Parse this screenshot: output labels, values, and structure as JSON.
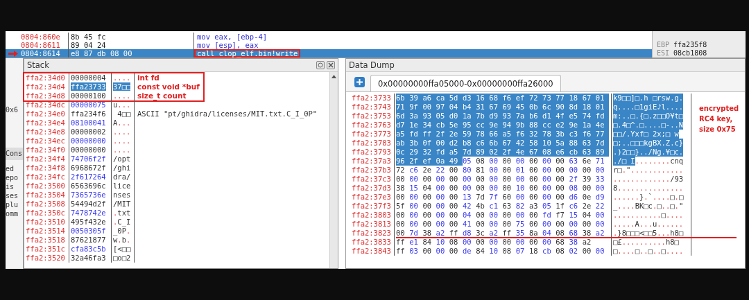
{
  "disassembly": {
    "rows": [
      {
        "address": "0804:860e",
        "bytes": "8b 45 fc",
        "instruction": "mov eax, [ebp-4]",
        "current": false,
        "annotated": false
      },
      {
        "address": "0804:8611",
        "bytes": "89 04 24",
        "instruction": "mov [esp], eax",
        "current": false,
        "annotated": false
      },
      {
        "address": "0804:8614",
        "bytes": "e8 87 db 08 00",
        "instruction": "call clop_elf.bin!write",
        "current": true,
        "annotated": true
      }
    ]
  },
  "registers": [
    {
      "name": "EBP",
      "value": "ffa235f8"
    },
    {
      "name": "ESI",
      "value": "08cb1808"
    }
  ],
  "side_panel": {
    "address": "0x6",
    "tab": "Cons",
    "lines": [
      "ed",
      "epo",
      "is",
      "ses",
      "plu",
      "omm"
    ]
  },
  "stack": {
    "title": "Stack",
    "annotated_rows": [
      {
        "address": "ffa2:34d0",
        "value": "00000004",
        "ascii": "....",
        "note": "int fd",
        "selected": false
      },
      {
        "address": "ffa2:34d4",
        "value": "ffa23733",
        "ascii": "37□□",
        "note": "const void *buf",
        "selected": true
      },
      {
        "address": "ffa2:34d8",
        "value": "00000100",
        "ascii": "....",
        "note": "size_t count",
        "selected": false
      }
    ],
    "rows": [
      {
        "address": "ffa2:34dc",
        "value": "00000075",
        "ascii": "u..."
      },
      {
        "address": "ffa2:34e0",
        "value": "ffa234f6",
        "ascii": " 4□□",
        "comment": "ASCII \"pt/ghidra/licenses/MIT.txt.C_I_0P\""
      },
      {
        "address": "ffa2:34e4",
        "value": "08100041",
        "ascii": "A..."
      },
      {
        "address": "ffa2:34e8",
        "value": "00000002",
        "ascii": "...."
      },
      {
        "address": "ffa2:34ec",
        "value": "00000000",
        "ascii": "...."
      },
      {
        "address": "ffa2:34f0",
        "value": "00000000",
        "ascii": "...."
      },
      {
        "address": "ffa2:34f4",
        "value": "74706f2f",
        "ascii": "/opt"
      },
      {
        "address": "ffa2:34f8",
        "value": "6968672f",
        "ascii": "/ghi"
      },
      {
        "address": "ffa2:34fc",
        "value": "2f617264",
        "ascii": "dra/"
      },
      {
        "address": "ffa2:3500",
        "value": "6563696c",
        "ascii": "lice"
      },
      {
        "address": "ffa2:3504",
        "value": "7365736e",
        "ascii": "nses"
      },
      {
        "address": "ffa2:3508",
        "value": "54494d2f",
        "ascii": "/MIT"
      },
      {
        "address": "ffa2:350c",
        "value": "7478742e",
        "ascii": ".txt"
      },
      {
        "address": "ffa2:3510",
        "value": "495f432e",
        "ascii": ".C_I"
      },
      {
        "address": "ffa2:3514",
        "value": "0050305f",
        "ascii": "_0P."
      },
      {
        "address": "ffa2:3518",
        "value": "87621877",
        "ascii": "w.b."
      },
      {
        "address": "ffa2:351c",
        "value": "cfa83c5b",
        "ascii": "[<□□"
      },
      {
        "address": "ffa2:3520",
        "value": "32a46fa3",
        "ascii": "□o□2"
      }
    ]
  },
  "data_dump": {
    "title": "Data Dump",
    "tab": "0x00000000ffa05000-0x00000000ffa26000",
    "annotation": "encrypted RC4 key, size 0x75",
    "rows": [
      {
        "address": "ffa2:3733",
        "selected_bytes": "6b 39 a6 ca 5d d3 16 68 f6 ef 72 73 77 18 67 01",
        "bytes": "",
        "selected_ascii": "k9□□]□.h □rsw.g.",
        "ascii": "",
        "underlined": false
      },
      {
        "address": "ffa2:3743",
        "selected_bytes": "71 9f 00 97 04 b4 31 67 69 45 0b 6c 90 8d 18 01",
        "bytes": "",
        "selected_ascii": "q....□1giE♪l....",
        "ascii": "",
        "underlined": false
      },
      {
        "address": "ffa2:3753",
        "selected_bytes": "6d 3a 93 05 d0 1a 7b d9 93 7a b6 d1 4f e5 74 fd",
        "bytes": "",
        "selected_ascii": "m:..□.{□.z□□O¥t□",
        "ascii": "",
        "underlined": false
      },
      {
        "address": "ffa2:3763",
        "selected_bytes": "d7 1e 34 cb 5e 95 cc 9e 94 9b 88 cc e2 9e 1a 4e",
        "bytes": "",
        "selected_ascii": "□.4□^.□....□-..N",
        "ascii": "",
        "underlined": false
      },
      {
        "address": "ffa2:3773",
        "selected_bytes": "a5 fd ff 2f 2e 59 78 66 a5 f6 32 78 3b c3 f6 77",
        "bytes": "",
        "selected_ascii": "□□/.Yxf□ 2x;□ w",
        "ascii": "",
        "underlined": false
      },
      {
        "address": "ffa2:3783",
        "selected_bytes": "ab 3b 0f 00 d2 b8 c6 6b 67 42 58 10 5a 88 63 7d",
        "bytes": "",
        "selected_ascii": "□;..□□□kgBX.Z.c}",
        "ascii": "",
        "underlined": false
      },
      {
        "address": "ffa2:3793",
        "selected_bytes": "0c 29 32 fd a5 7d 89 02 2f 4e 67 08 e6 cb 63 89",
        "bytes": "",
        "selected_ascii": ".)2□□}../Ng.¥□c.",
        "ascii": "",
        "underlined": false
      },
      {
        "address": "ffa2:37a3",
        "selected_bytes": "96 2f ef 0a 49",
        "bytes": "05 08 00 00 00 00 00 00 63 6e 71",
        "selected_ascii": "./□ I",
        "ascii": "........cnq",
        "underlined": false
      },
      {
        "address": "ffa2:37b3",
        "selected_bytes": "",
        "bytes": "72 c6 2e 22 00 80 81 00 00 01 00 00 00 00 00 00",
        "selected_ascii": "",
        "ascii": "r□.\"............",
        "underlined": false
      },
      {
        "address": "ffa2:37c3",
        "selected_bytes": "",
        "bytes": "00 00 00 00 00 00 00 00 00 00 00 00 00 2f 39 33",
        "selected_ascii": "",
        "ascii": "............./93",
        "underlined": false
      },
      {
        "address": "ffa2:37d3",
        "selected_bytes": "",
        "bytes": "38 15 04 00 00 00 00 00 00 10 00 00 00 08 00 00",
        "selected_ascii": "",
        "ascii": "8...............",
        "underlined": false
      },
      {
        "address": "ffa2:37e3",
        "selected_bytes": "",
        "bytes": "00 00 00 00 00 13 7d 7f 60 00 00 00 00 d6 0e d9",
        "selected_ascii": "",
        "ascii": "......}.`....□.□",
        "underlined": false
      },
      {
        "address": "ffa2:37f3",
        "selected_bytes": "",
        "bytes": "5f 00 00 00 00 42 4b c1 63 82 a3 05 1f c6 2e 22",
        "selected_ascii": "",
        "ascii": "_....BK□c.□..□.\"",
        "underlined": false
      },
      {
        "address": "ffa2:3803",
        "selected_bytes": "",
        "bytes": "00 00 00 00 00 04 00 00 00 00 00 fd f7 15 04 00",
        "selected_ascii": "",
        "ascii": "...........□....",
        "underlined": false
      },
      {
        "address": "ffa2:3813",
        "selected_bytes": "",
        "bytes": "00 00 00 00 00 41 00 00 00 75 00 00 00 00 00 00",
        "selected_ascii": "",
        "ascii": ".....A...u......",
        "underlined": false
      },
      {
        "address": "ffa2:3823",
        "selected_bytes": "",
        "bytes": "00 7d 38 a2 ff d8 3c a2 ff 35 8a 04 08 68 38 a2",
        "selected_ascii": "",
        "ascii": ".}8□□□<□□5...h8□",
        "underlined": true
      },
      {
        "address": "ffa2:3833",
        "selected_bytes": "",
        "bytes": "ff e1 84 10 08 00 00 00 00 00 00 00 68 38 a2",
        "selected_ascii": "",
        "ascii": "□£..........h8□",
        "underlined": false
      },
      {
        "address": "ffa2:3843",
        "selected_bytes": "",
        "bytes": "ff 03 00 00 00 de 84 10 08 07 18 cb 08 02 00 00",
        "selected_ascii": "",
        "ascii": "□....□..□..□....",
        "underlined": false
      }
    ]
  }
}
